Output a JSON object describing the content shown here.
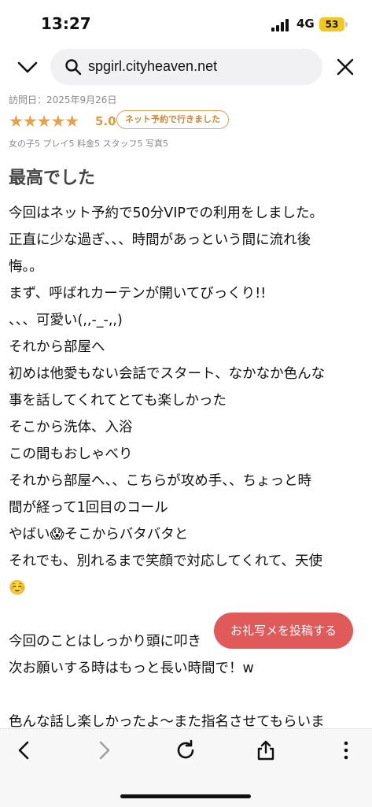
{
  "status": {
    "time": "13:27",
    "network": "4G",
    "battery": "53"
  },
  "browser": {
    "url": "spgirl.cityheaven.net"
  },
  "review": {
    "visit_date": "訪問日：2025年9月26日",
    "stars": "★★★★★",
    "score": "5.0",
    "badge": "ネット予約で行きました",
    "subscores": "女の子5 プレイ5 料金5 スタッフ5 写真5",
    "title": "最高でした",
    "lines": [
      "今回はネット予約で50分VIPでの利用をしました。",
      "正直に少な過ぎ、、、時間があっという間に流れ後",
      "悔。。",
      "まず、呼ばれカーテンが開いてびっくり!!",
      "、、、可愛い(,,-_-,,)",
      "それから部屋へ",
      "初めは他愛もない会話でスタート、なかなか色んな",
      "事を話してくれてとても楽しかった",
      "そこから洗体、入浴",
      "この間もおしゃべり",
      "それから部屋へ、、こちらが攻め手、、ちょっと時",
      "間が経って1回目のコール",
      "やばい😱そこからバタバタと",
      "それでも、別れるまで笑顔で対応してくれて、天使",
      "☺️",
      "",
      "今回のことはしっかり頭に叩き",
      "次お願いする時はもっと長い時間で！w",
      "",
      "色んな話し楽しかったよ〜また指名させてもらいま"
    ]
  },
  "fab": {
    "label": "お礼写メを投稿する"
  },
  "colors": {
    "accent_star": "#e5a24a",
    "fab": "#e05a5a",
    "battery": "#f2c81f"
  }
}
